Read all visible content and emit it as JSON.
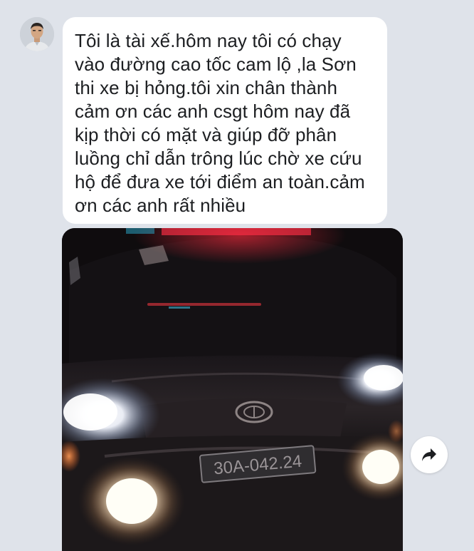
{
  "message": {
    "text": "Tôi là tài xế.hôm nay tôi có chạy\nvào đường cao tốc cam lộ ,la Sơn\nthi xe bị hỏng.tôi xin chân thành\ncảm ơn các anh csgt hôm nay đã\nkịp thời có mặt và giúp đỡ phân\nluồng chỉ dẫn trông lúc chờ xe cứu\nhộ để đưa xe tới điểm an toàn.cảm\nơn các anh rất nhiều"
  },
  "attachment": {
    "plate_text": "30A-042.24"
  },
  "icons": {
    "share": "share-arrow-icon",
    "avatar": "profile-photo"
  },
  "colors": {
    "background": "#dfe3ea",
    "bubble": "#ffffff",
    "text": "#1c1e21"
  }
}
